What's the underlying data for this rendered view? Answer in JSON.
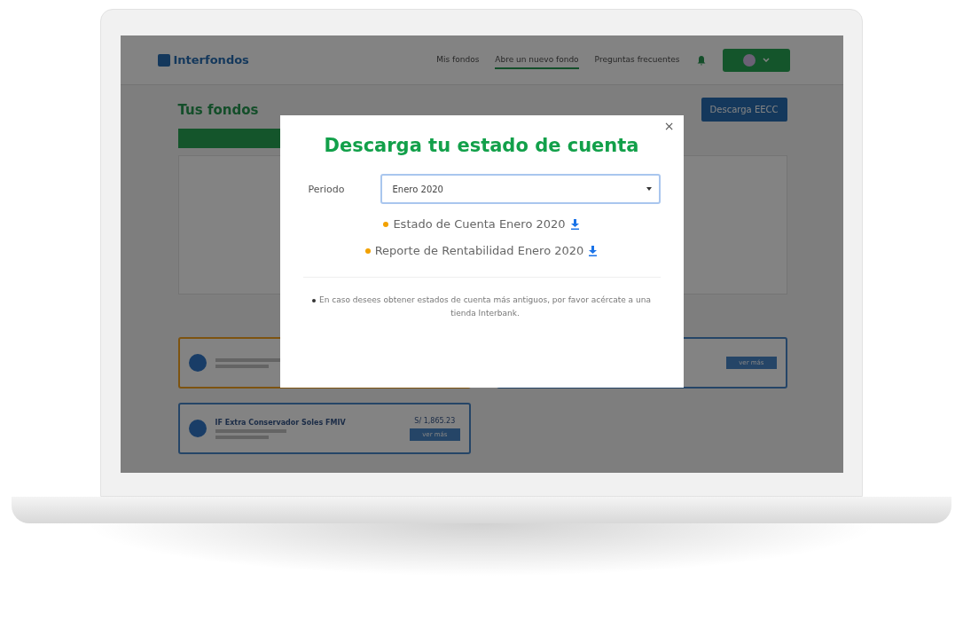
{
  "header": {
    "logo": "Interfondos",
    "nav": [
      {
        "label": "Mis fondos",
        "selected": false
      },
      {
        "label": "Abre un nuevo fondo",
        "selected": true
      },
      {
        "label": "Preguntas frecuentes",
        "selected": false
      }
    ]
  },
  "page": {
    "title": "Tus fondos",
    "download_button": "Descarga EECC"
  },
  "funds": [
    {
      "highlighted": true
    },
    {
      "highlighted": false,
      "action": "ver más"
    },
    {
      "highlighted": false,
      "name": "IF Extra Conservador Soles FMIV",
      "amount": "S/ 1,865.23",
      "action": "ver más"
    }
  ],
  "modal": {
    "close": "×",
    "title": "Descarga tu estado de cuenta",
    "period_label": "Periodo",
    "period_value": "Enero 2020",
    "links": [
      {
        "label": "Estado de Cuenta Enero 2020"
      },
      {
        "label": "Reporte de Rentabilidad Enero 2020"
      }
    ],
    "note": "En caso desees obtener estados de cuenta más antiguos, por favor acércate a una tienda Interbank."
  }
}
